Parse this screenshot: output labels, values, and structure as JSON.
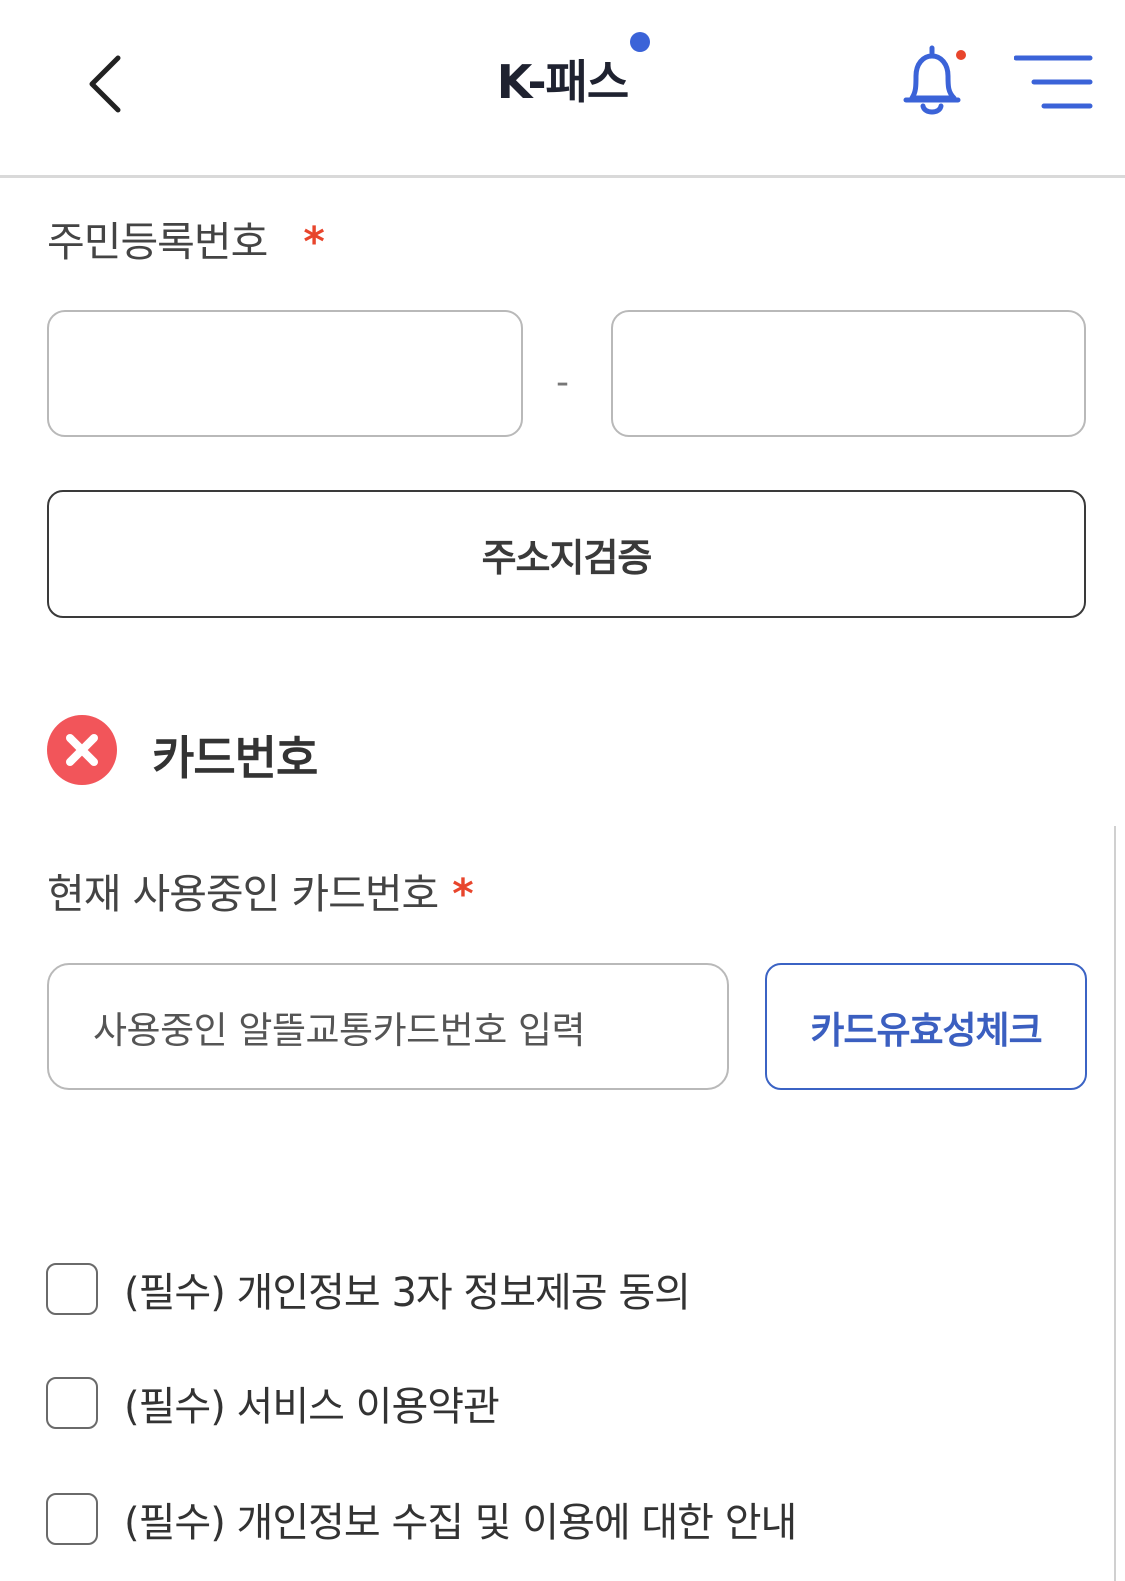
{
  "header": {
    "title": "K-패스",
    "accent_color": "#3b63d8",
    "alert_color": "#e8452c",
    "icons": {
      "back": "chevron-left-icon",
      "bell": "bell-icon",
      "menu": "menu-icon"
    }
  },
  "resident": {
    "label": "주민등록번호",
    "required_mark": "*",
    "separator": "-",
    "front_value": "",
    "back_value": "",
    "verify_button": "주소지검증"
  },
  "card": {
    "status_icon": "error-x-icon",
    "section_title": "카드번호",
    "label": "현재 사용중인 카드번호",
    "required_mark": "*",
    "input_placeholder": "사용중인 알뜰교통카드번호 입력",
    "check_button": "카드유효성체크"
  },
  "agreements": [
    {
      "label": "(필수) 개인정보 3자 정보제공 동의",
      "checked": false
    },
    {
      "label": "(필수) 서비스 이용약관",
      "checked": false
    },
    {
      "label": "(필수) 개인정보 수집 및 이용에 대한 안내",
      "checked": false
    }
  ]
}
